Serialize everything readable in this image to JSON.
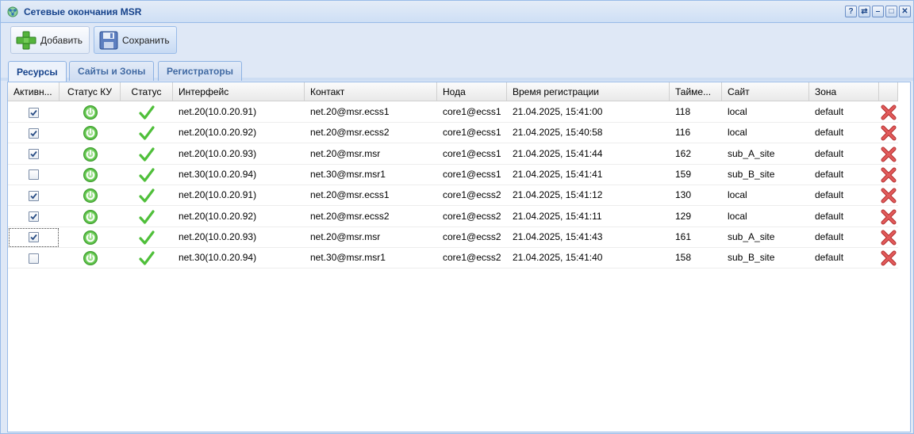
{
  "window": {
    "title": "Сетевые окончания MSR",
    "tools": [
      "?",
      "⇄",
      "–",
      "□",
      "✕"
    ]
  },
  "toolbar": {
    "add_label": "Добавить",
    "save_label": "Сохранить"
  },
  "tabs": [
    {
      "label": "Ресурсы",
      "active": true
    },
    {
      "label": "Сайты и Зоны",
      "active": false
    },
    {
      "label": "Регистраторы",
      "active": false
    }
  ],
  "columns": [
    "Активн...",
    "Статус КУ",
    "Статус",
    "Интерфейс",
    "Контакт",
    "Нода",
    "Время регистрации",
    "Тайме...",
    "Сайт",
    "Зона"
  ],
  "colors": {
    "status_green": "#4fbf3a",
    "delete_red": "#d94040",
    "header_blue": "#15428b"
  },
  "rows": [
    {
      "active": true,
      "interface": "net.20(10.0.20.91)",
      "contact": "net.20@msr.ecss1",
      "node": "core1@ecss1",
      "time": "21.04.2025, 15:41:00",
      "timeout": "118",
      "site": "local",
      "zone": "default"
    },
    {
      "active": true,
      "interface": "net.20(10.0.20.92)",
      "contact": "net.20@msr.ecss2",
      "node": "core1@ecss1",
      "time": "21.04.2025, 15:40:58",
      "timeout": "116",
      "site": "local",
      "zone": "default"
    },
    {
      "active": true,
      "interface": "net.20(10.0.20.93)",
      "contact": "net.20@msr.msr",
      "node": "core1@ecss1",
      "time": "21.04.2025, 15:41:44",
      "timeout": "162",
      "site": "sub_A_site",
      "zone": "default"
    },
    {
      "active": false,
      "interface": "net.30(10.0.20.94)",
      "contact": "net.30@msr.msr1",
      "node": "core1@ecss1",
      "time": "21.04.2025, 15:41:41",
      "timeout": "159",
      "site": "sub_B_site",
      "zone": "default"
    },
    {
      "active": true,
      "interface": "net.20(10.0.20.91)",
      "contact": "net.20@msr.ecss1",
      "node": "core1@ecss2",
      "time": "21.04.2025, 15:41:12",
      "timeout": "130",
      "site": "local",
      "zone": "default"
    },
    {
      "active": true,
      "interface": "net.20(10.0.20.92)",
      "contact": "net.20@msr.ecss2",
      "node": "core1@ecss2",
      "time": "21.04.2025, 15:41:11",
      "timeout": "129",
      "site": "local",
      "zone": "default"
    },
    {
      "active": true,
      "interface": "net.20(10.0.20.93)",
      "contact": "net.20@msr.msr",
      "node": "core1@ecss2",
      "time": "21.04.2025, 15:41:43",
      "timeout": "161",
      "site": "sub_A_site",
      "zone": "default",
      "focused": true
    },
    {
      "active": false,
      "interface": "net.30(10.0.20.94)",
      "contact": "net.30@msr.msr1",
      "node": "core1@ecss2",
      "time": "21.04.2025, 15:41:40",
      "timeout": "158",
      "site": "sub_B_site",
      "zone": "default"
    }
  ]
}
